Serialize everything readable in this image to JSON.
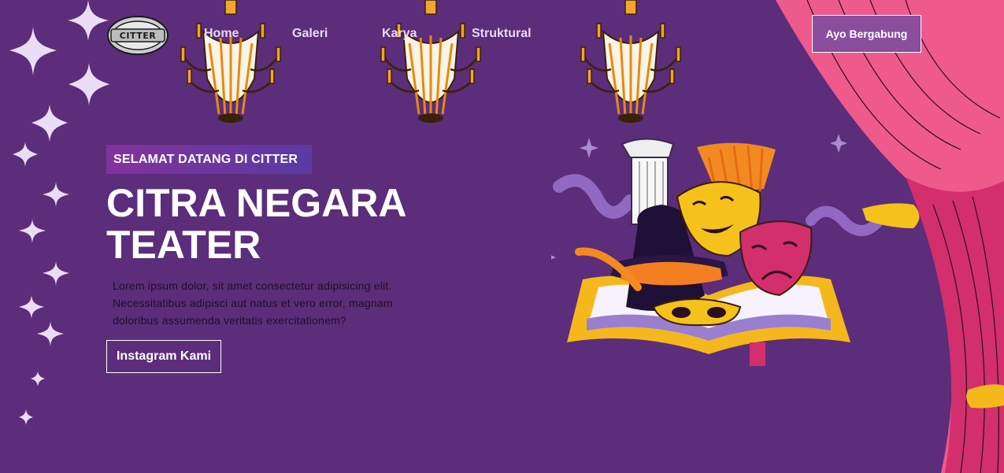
{
  "brand": {
    "logo_text": "CITTER"
  },
  "nav": {
    "items": [
      {
        "label": "Home"
      },
      {
        "label": "Galeri"
      },
      {
        "label": "Karya"
      },
      {
        "label": "Struktural"
      }
    ],
    "join_label": "Ayo Bergabung"
  },
  "hero": {
    "badge": "SELAMAT DATANG DI CITTER",
    "title_line1": "CITRA NEGARA",
    "title_line2": "TEATER",
    "description": "Lorem ipsum dolor, sit amet consectetur adipisicing elit. Necessitatibus adipisci aut natus et vero error, magnam doloribus assumenda veritatis exercitationem?",
    "cta_label": "Instagram Kami"
  },
  "icons": [
    "sparkle-icon",
    "chandelier-icon",
    "theater-masks-icon",
    "curtain-icon"
  ],
  "colors": {
    "background": "#5c2d7b",
    "curtain_pink": "#ef5a8c",
    "curtain_dark": "#d22f6c",
    "accent_gold": "#f5b81c",
    "badge_gradient_start": "#82339c",
    "badge_gradient_end": "#5a3aa3"
  }
}
